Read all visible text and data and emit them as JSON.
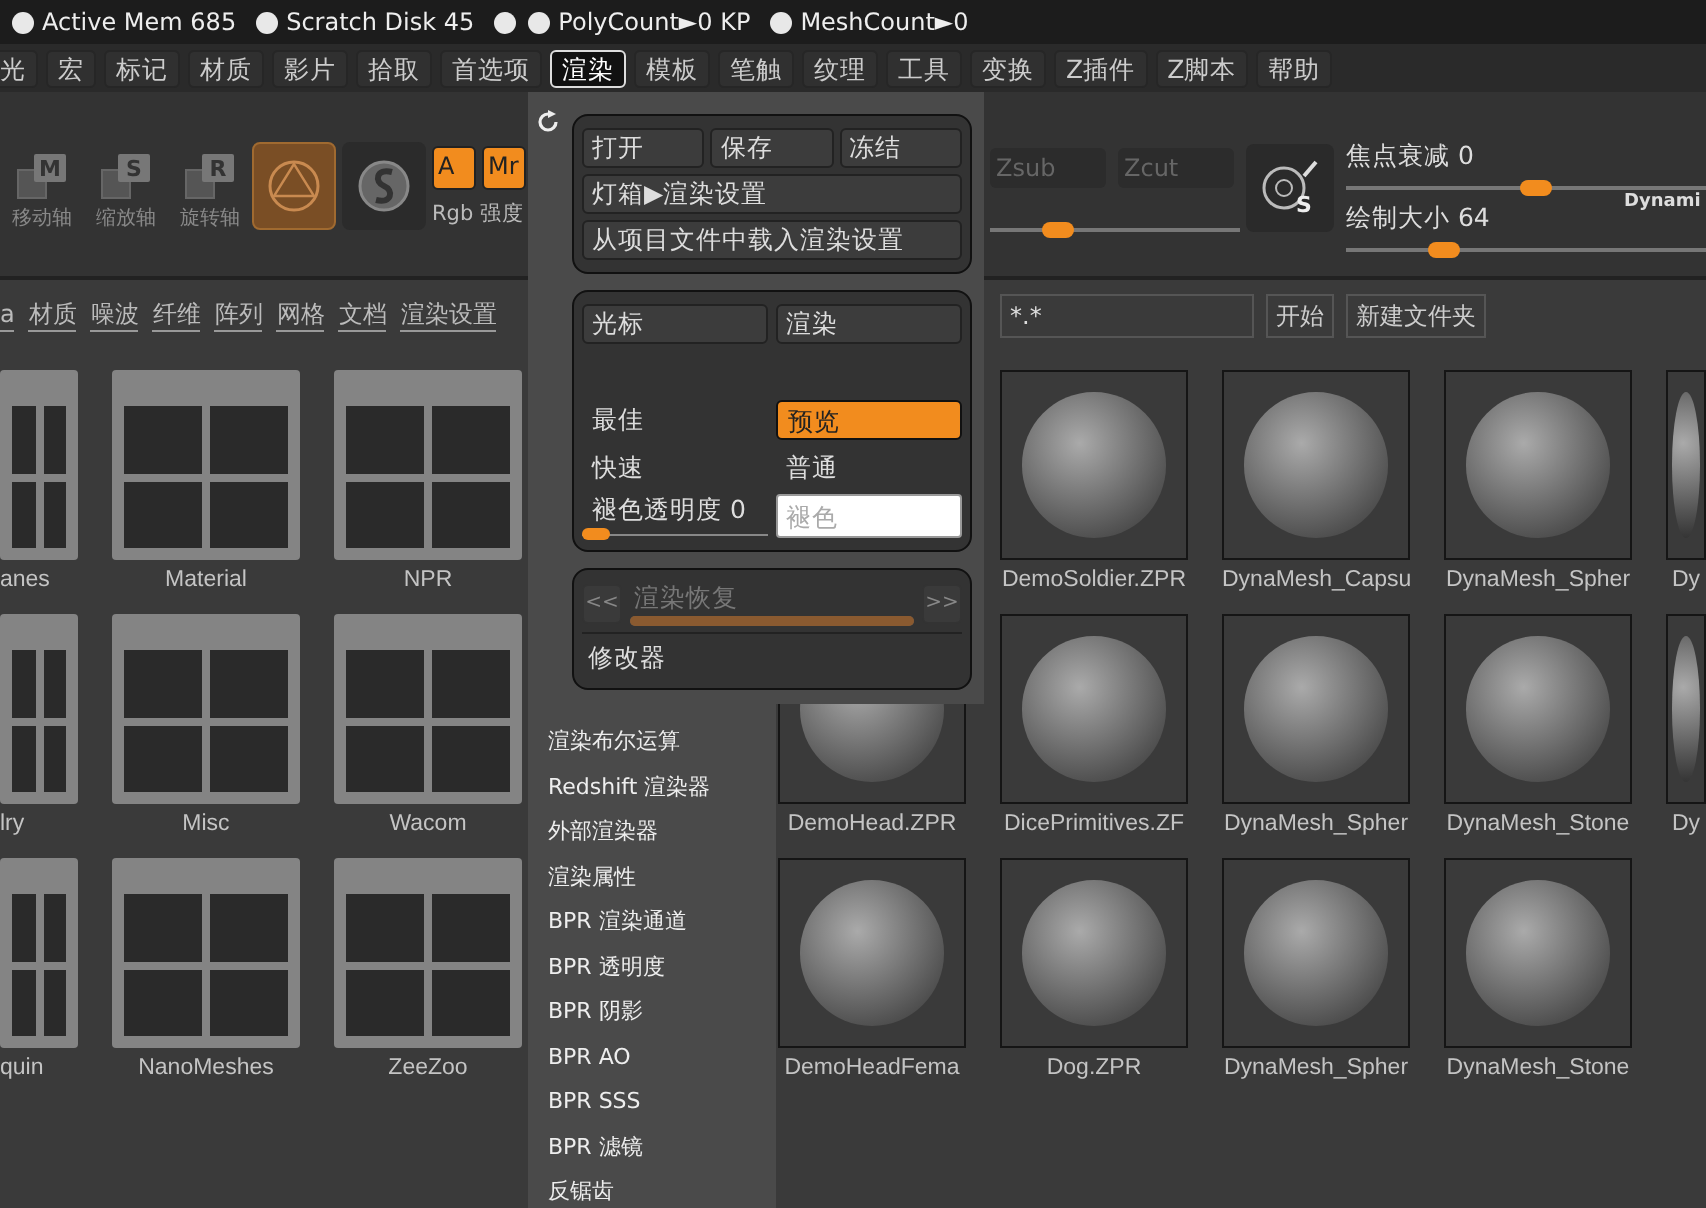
{
  "status_bar": [
    {
      "kind": "stat",
      "label": "Active Mem 685"
    },
    {
      "kind": "stat",
      "label": "Scratch Disk 45"
    },
    {
      "kind": "dot"
    },
    {
      "kind": "stat",
      "label": "PolyCount►0 KP"
    },
    {
      "kind": "stat",
      "label": "MeshCount►0"
    }
  ],
  "menu_bar": [
    {
      "label": "光",
      "selected": false
    },
    {
      "label": "宏",
      "selected": false
    },
    {
      "label": "标记",
      "selected": false
    },
    {
      "label": "材质",
      "selected": false
    },
    {
      "label": "影片",
      "selected": false
    },
    {
      "label": "拾取",
      "selected": false
    },
    {
      "label": "首选项",
      "selected": false
    },
    {
      "label": "渲染",
      "selected": true
    },
    {
      "label": "模板",
      "selected": false
    },
    {
      "label": "笔触",
      "selected": false
    },
    {
      "label": "纹理",
      "selected": false
    },
    {
      "label": "工具",
      "selected": false
    },
    {
      "label": "变换",
      "selected": false
    },
    {
      "label": "Z插件",
      "selected": false
    },
    {
      "label": "Z脚本",
      "selected": false
    },
    {
      "label": "帮助",
      "selected": false
    }
  ],
  "toolbar": {
    "axis_tools": [
      {
        "key": "M",
        "label": "移动轴"
      },
      {
        "key": "S",
        "label": "缩放轴"
      },
      {
        "key": "R",
        "label": "旋转轴"
      }
    ],
    "mode_buttons": [
      {
        "selected": true
      },
      {
        "selected": false
      }
    ],
    "channel_buttons": [
      {
        "label": "A",
        "selected": true
      },
      {
        "label": "Mr",
        "selected": true
      }
    ],
    "rgb_label": "Rgb 强度",
    "z_buttons": [
      {
        "label": "Zsub",
        "disabled": true
      },
      {
        "label": "Zcut",
        "disabled": true
      }
    ],
    "intensity_slider": {
      "level": 0.27
    },
    "sliders": [
      {
        "label": "焦点衰减 0",
        "level": 0.5
      },
      {
        "label": "绘制大小 64",
        "level": 0.26
      }
    ],
    "brush_key": "S",
    "dynamic_label": "Dynami"
  },
  "sub_tabs": [
    "a",
    "材质",
    "噪波",
    "纤维",
    "阵列",
    "网格",
    "文档",
    "渲染设置"
  ],
  "search": {
    "value": "*.*"
  },
  "browser_buttons": [
    "开始",
    "新建文件夹"
  ],
  "file_grid": [
    [
      {
        "kind": "folder",
        "label": "anes"
      },
      {
        "kind": "folder",
        "label": "Material"
      },
      {
        "kind": "folder",
        "label": "NPR"
      },
      {
        "kind": "covered"
      },
      {
        "kind": "covered"
      },
      {
        "kind": "file",
        "label": "DemoSoldier.ZPR"
      },
      {
        "kind": "file",
        "label": "DynaMesh_Capsu"
      },
      {
        "kind": "file",
        "label": "DynaMesh_Spher"
      },
      {
        "kind": "file",
        "label": "Dy"
      }
    ],
    [
      {
        "kind": "folder",
        "label": "lry"
      },
      {
        "kind": "folder",
        "label": "Misc"
      },
      {
        "kind": "folder",
        "label": "Wacom"
      },
      {
        "kind": "covered"
      },
      {
        "kind": "file",
        "label": "DemoHead.ZPR"
      },
      {
        "kind": "file",
        "label": "DicePrimitives.ZF"
      },
      {
        "kind": "file",
        "label": "DynaMesh_Spher"
      },
      {
        "kind": "file",
        "label": "DynaMesh_Stone"
      },
      {
        "kind": "file",
        "label": "Dy"
      }
    ],
    [
      {
        "kind": "folder",
        "label": "quin"
      },
      {
        "kind": "folder",
        "label": "NanoMeshes"
      },
      {
        "kind": "folder",
        "label": "ZeeZoo"
      },
      {
        "kind": "covered"
      },
      {
        "kind": "file",
        "label": "DemoHeadFema"
      },
      {
        "kind": "file",
        "label": "Dog.ZPR"
      },
      {
        "kind": "file",
        "label": "DynaMesh_Spher"
      },
      {
        "kind": "file",
        "label": "DynaMesh_Stone"
      },
      {
        "kind": "covered"
      }
    ]
  ],
  "render_menu": {
    "top_buttons": [
      "打开",
      "保存",
      "冻结"
    ],
    "wide_buttons": [
      "灯箱▶渲染设置",
      "从项目文件中载入渲染设置"
    ],
    "mode_buttons": [
      "光标",
      "渲染"
    ],
    "quality": [
      {
        "label": "最佳",
        "selected": false
      },
      {
        "label": "预览",
        "selected": true
      },
      {
        "label": "快速",
        "selected": false
      },
      {
        "label": "普通",
        "selected": false
      }
    ],
    "fade_slider": {
      "label": "褪色透明度 0",
      "level": 0
    },
    "fade_color": {
      "placeholder": "褪色"
    },
    "restore": {
      "prev": "<<",
      "label": "渲染恢复",
      "next": ">>",
      "disabled": true,
      "level": 1
    },
    "modifier": "修改器",
    "items": [
      "渲染布尔运算",
      "Redshift 渲染器",
      "外部渲染器",
      "渲染属性",
      "BPR 渲染通道",
      "BPR 透明度",
      "BPR 阴影",
      "BPR AO",
      "BPR SSS",
      "BPR 滤镜",
      "反锯齿"
    ]
  }
}
